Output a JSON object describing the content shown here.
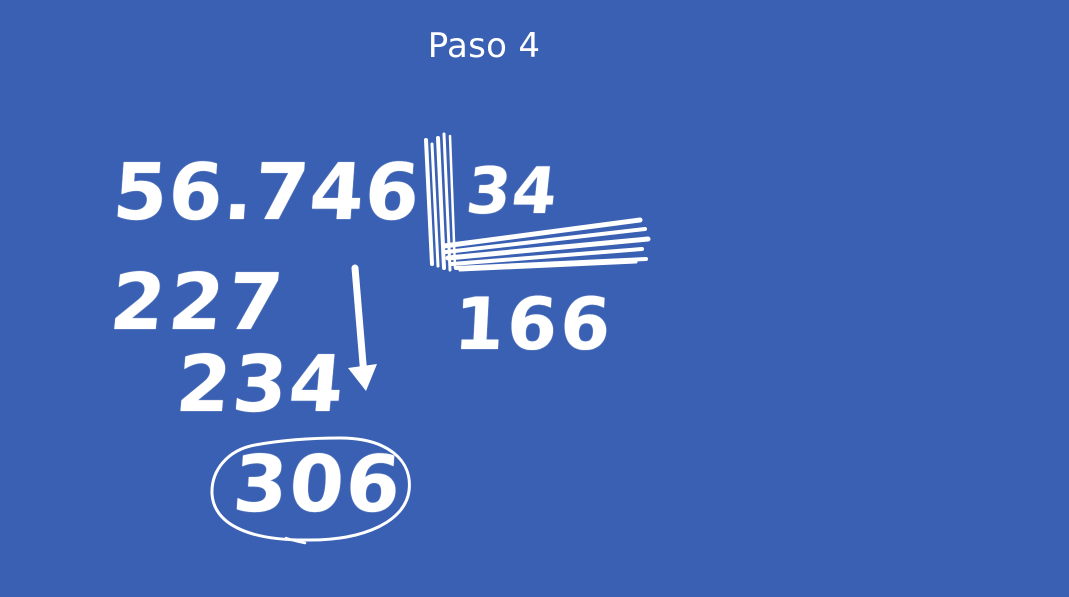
{
  "slide": {
    "title": "Paso 4",
    "background_color": "#3a60b3",
    "ink_color": "#ffffff"
  },
  "division": {
    "dividend": "56.746",
    "divisor": "34",
    "quotient": "166",
    "partials": [
      "227",
      "234"
    ],
    "remainder": "306"
  }
}
